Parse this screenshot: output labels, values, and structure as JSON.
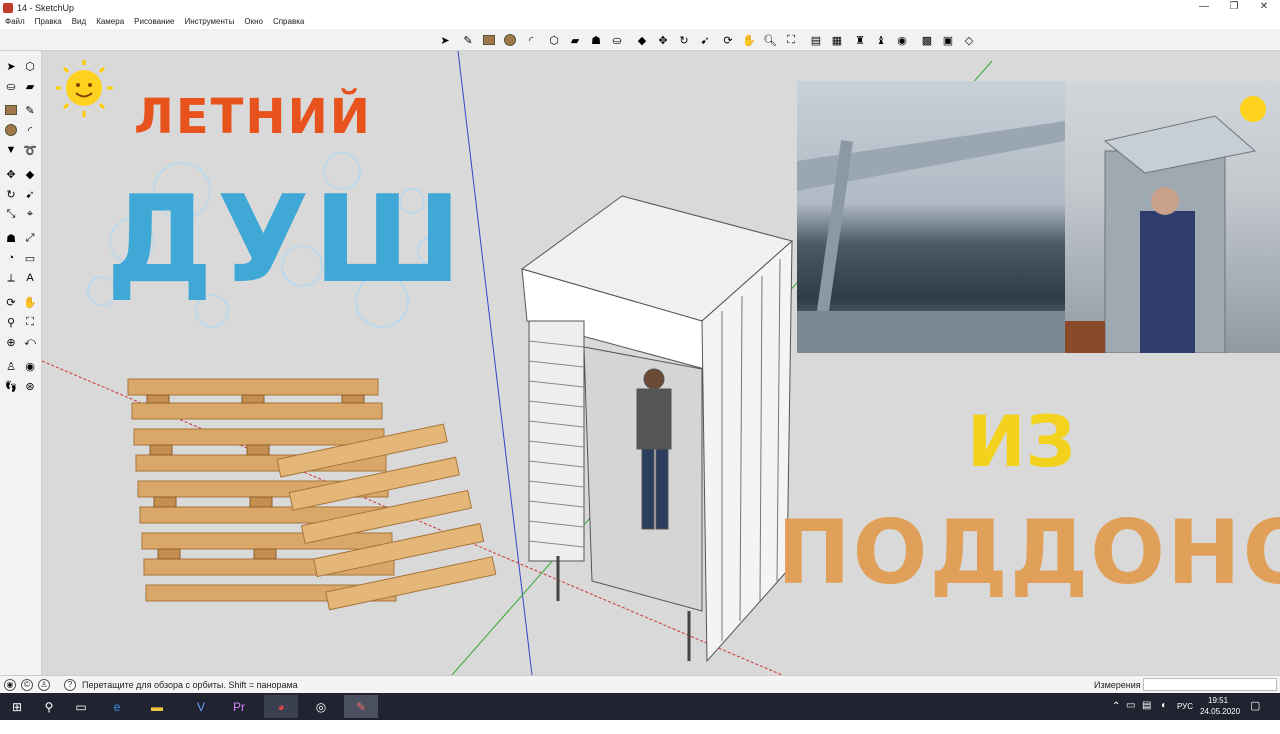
{
  "window": {
    "title": "14 - SketchUp",
    "minimize": "—",
    "maximize": "❐",
    "close": "✕"
  },
  "menu": [
    "Файл",
    "Правка",
    "Вид",
    "Камера",
    "Рисование",
    "Инструменты",
    "Окно",
    "Справка"
  ],
  "thumbnail": {
    "line1": "ЛЕТНИЙ",
    "line2": "ДУШ",
    "line3": "ИЗ",
    "line4": "ПОДДОНОВ"
  },
  "colors": {
    "letniy": "#e8521d",
    "dush": "#3fa8d6",
    "iz": "#f2d21c",
    "poddonov": "#e0a05a",
    "axis_red": "#cc3333",
    "axis_blue": "#3344cc",
    "axis_green": "#33aa33"
  },
  "status": {
    "hint": "Перетащите для обзора с орбиты.  Shift = панорама",
    "measure_label": "Измерения",
    "measure_value": ""
  },
  "tray": {
    "lang": "РУС",
    "time": "19:51",
    "date": "24.05.2020"
  }
}
